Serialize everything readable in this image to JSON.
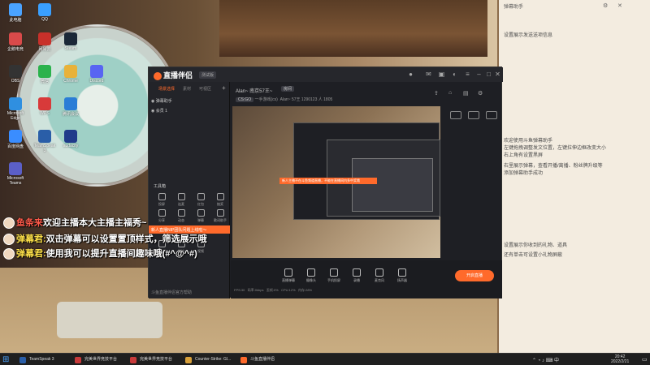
{
  "desktop": {
    "icons": [
      {
        "label": "此电脑",
        "color": "#4aa3ff"
      },
      {
        "label": "QQ",
        "color": "#3aa0ff"
      },
      {
        "label": "企鹅电竞",
        "color": "#d94a4a"
      },
      {
        "label": "网易云",
        "color": "#c8302a"
      },
      {
        "label": "Steam",
        "color": "#1b2838"
      },
      {
        "label": "OBS",
        "color": "#333333"
      },
      {
        "label": "微信",
        "color": "#2bb24c"
      },
      {
        "label": "Chrome",
        "color": "#e8b23a"
      },
      {
        "label": "Discord",
        "color": "#5865f2"
      },
      {
        "label": "Microsoft Edge",
        "color": "#2f8fe0"
      },
      {
        "label": "WPS",
        "color": "#d83a3a"
      },
      {
        "label": "腾讯会议",
        "color": "#2a7dd6"
      },
      {
        "label": "百度网盘",
        "color": "#3a8dff"
      },
      {
        "label": "TeamSpeak 3",
        "color": "#2a5ea8"
      },
      {
        "label": "audacity",
        "color": "#1f3a8a"
      },
      {
        "label": "Microsoft Teams",
        "color": "#5b5fc7"
      }
    ]
  },
  "right_panel": {
    "title": "弹幕助手",
    "lines": [
      "设置展示发送送项信息",
      "欢迎使用斗鱼弹幕助手",
      "左键拖拽调整发文位置，左键拉伸边框改变大小",
      "右上角有设置黑屏",
      "右里展示弹幕，查看开播/离播、粉丝牌升级等",
      "添加弹幕助手成功",
      "设置展示你收到的礼物、道具",
      "还有单击可设置小礼物屏蔽"
    ],
    "date": "2022/2/21"
  },
  "app": {
    "logo": "直播伴侣",
    "version": "测试版",
    "side_tabs": [
      "场景选择",
      "素材",
      "可视区"
    ],
    "sources": [
      "弹幕助手",
      "会员 1"
    ],
    "tools_title": "工具箱",
    "tools": [
      "投屏",
      "连麦",
      "红包",
      "抽奖",
      "分享",
      "动态",
      "弹幕",
      "歌词助手",
      "送礼物",
      "推流",
      "视频"
    ],
    "orange_bar": "新人直播NIP团队问题上线啦～",
    "side_footer": "斗鱼直播伴侣官方帮助",
    "room": "Alan~ 南京57王~",
    "room_tag": "房间",
    "category": "CS:GO",
    "category_tag": "一手游戏(cs)",
    "info": "Alan~ 57王   1290123   人 1805",
    "preview_banner": "新人主播不在斗鱼频道直播，不能在直播间内多中奖哦",
    "bottom_buttons": [
      "直播弹幕",
      "摄像头",
      "手机投屏",
      "录播",
      "麦克风",
      "扬声器"
    ],
    "start_button": "开启直播",
    "status": [
      "FPS:30",
      "码率:0kbps",
      "丢帧:0%",
      "CPU:12%",
      "内存:28%"
    ]
  },
  "danmaku": [
    {
      "nick": "鱼条来",
      "msg": "欢迎主播本大主播主福秀~",
      "nick_color": "#ff5a4a"
    },
    {
      "nick": "弹幕君:",
      "msg": "双击弹幕可以设置置顶样式，筛选展示哦",
      "nick_color": "#ffe24a"
    },
    {
      "nick": "弹幕君:",
      "msg": "使用我可以提升直播间趣味哦(#^@^#)",
      "nick_color": "#ffe24a"
    }
  ],
  "taskbar": {
    "items": [
      {
        "label": "TeamSpeak 3",
        "color": "#2a5ea8"
      },
      {
        "label": "完美世界竞技平台",
        "color": "#c83a3a"
      },
      {
        "label": "完美世界竞技平台",
        "color": "#c83a3a"
      },
      {
        "label": "Counter-Strike: Gl...",
        "color": "#d8a03a"
      },
      {
        "label": "斗鱼直播伴侣",
        "color": "#ff6a2b"
      }
    ],
    "time": "20:42",
    "date": "2022/2/21"
  }
}
